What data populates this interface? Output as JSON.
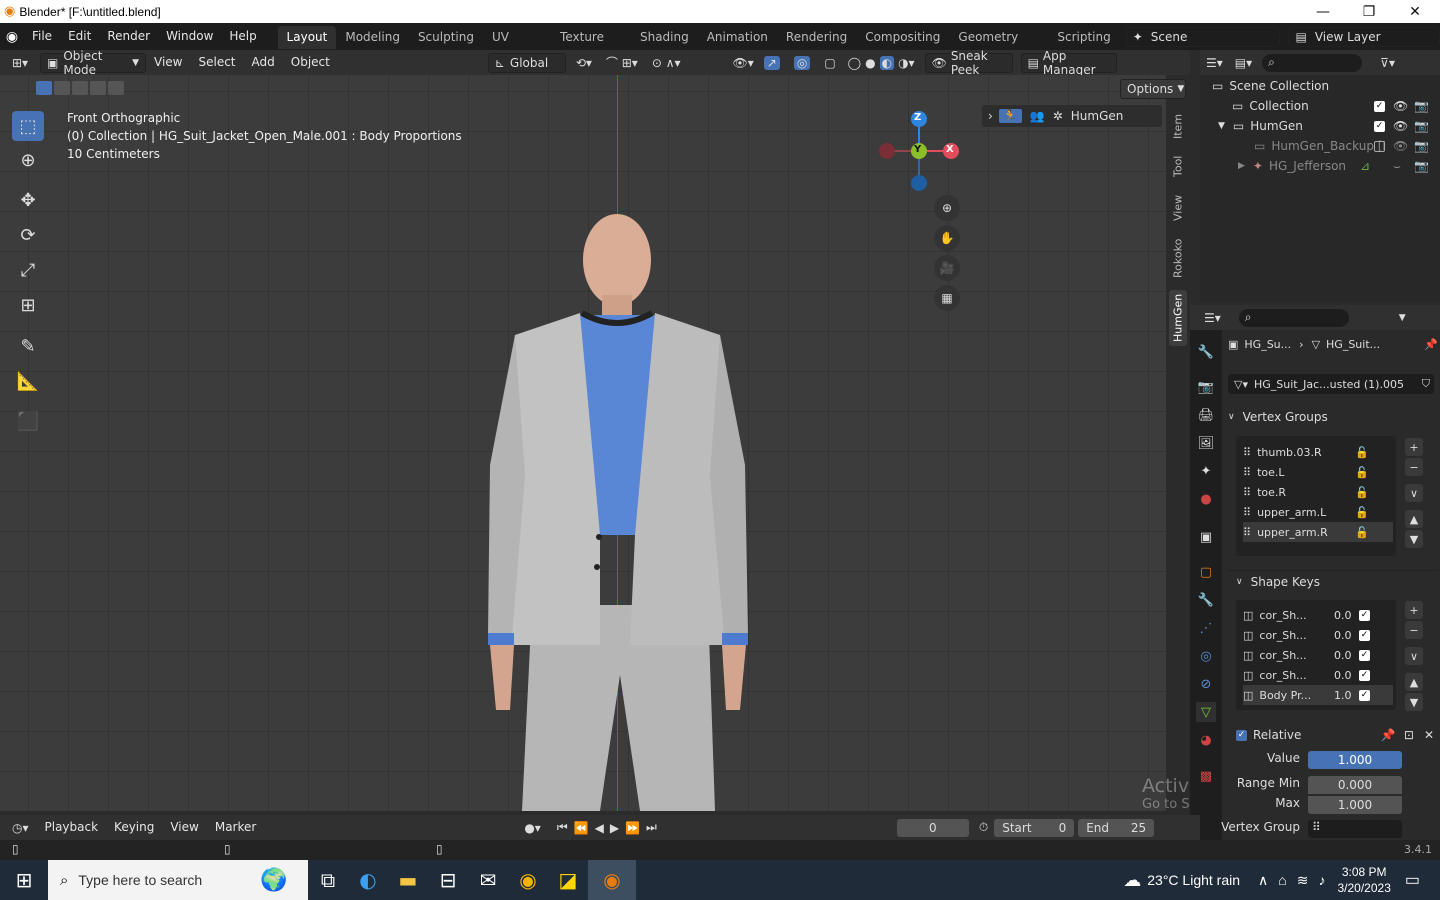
{
  "title_bar": {
    "text": "Blender* [F:\\untitled.blend]",
    "minimize": "—",
    "maximize": "❐",
    "close": "✕"
  },
  "menu": {
    "items": [
      "File",
      "Edit",
      "Render",
      "Window",
      "Help"
    ]
  },
  "workspaces": {
    "tabs": [
      "Layout",
      "Modeling",
      "Sculpting",
      "UV Editing",
      "Texture Paint",
      "Shading",
      "Animation",
      "Rendering",
      "Compositing",
      "Geometry Nodes",
      "Scripting"
    ],
    "active": "Layout"
  },
  "scene": {
    "name": "Scene",
    "view_layer": "View Layer"
  },
  "viewport_header": {
    "mode": "Object Mode",
    "menus": [
      "View",
      "Select",
      "Add",
      "Object"
    ],
    "transform": "Global",
    "sneak_peek": "Sneak Peek",
    "app_manager": "App Manager",
    "options": "Options"
  },
  "viewport": {
    "line1": "Front Orthographic",
    "line2": "(0) Collection | HG_Suit_Jacket_Open_Male.001 : Body Proportions",
    "line3": "10 Centimeters",
    "gizmo_z": "Z",
    "gizmo_y": "Y",
    "gizmo_x": "X",
    "humgen_label": "HumGen"
  },
  "side_tabs": [
    "Item",
    "Tool",
    "View",
    "Rokoko",
    "HumGen"
  ],
  "outliner": {
    "rows": [
      {
        "label": "Scene Collection"
      },
      {
        "label": "Collection"
      },
      {
        "label": "HumGen"
      },
      {
        "label": "HumGen_Backup [I"
      },
      {
        "label": "HG_Jefferson"
      }
    ]
  },
  "properties": {
    "breadcrumb1": "HG_Su...",
    "breadcrumb2": "HG_Suit...",
    "mesh_name": "HG_Suit_Jac...usted (1).005",
    "vertex_groups_title": "Vertex Groups",
    "vertex_groups": [
      "thumb.03.R",
      "toe.L",
      "toe.R",
      "upper_arm.L",
      "upper_arm.R"
    ],
    "shape_keys_title": "Shape Keys",
    "shape_keys": [
      {
        "name": "cor_Sh...",
        "value": "0.0"
      },
      {
        "name": "cor_Sh...",
        "value": "0.0"
      },
      {
        "name": "cor_Sh...",
        "value": "0.0"
      },
      {
        "name": "cor_Sh...",
        "value": "0.0"
      },
      {
        "name": "Body Pr...",
        "value": "1.0"
      }
    ],
    "relative_label": "Relative",
    "value_label": "Value",
    "value": "1.000",
    "range_min_label": "Range Min",
    "range_min": "0.000",
    "max_label": "Max",
    "max": "1.000",
    "vertex_group_label": "Vertex Group"
  },
  "timeline": {
    "menus": [
      "Playback",
      "Keying",
      "View",
      "Marker"
    ],
    "frame": "0",
    "start_label": "Start",
    "start": "0",
    "end_label": "End",
    "end": "25"
  },
  "status": {
    "version": "3.4.1"
  },
  "watermark": {
    "line1": "Activate Windows",
    "line2": "Go to Settings to activate Windows."
  },
  "taskbar": {
    "search_placeholder": "Type here to search",
    "weather": "23°C  Light rain",
    "time": "3:08 PM",
    "date": "3/20/2023"
  },
  "colors": {
    "accent": "#4772b3",
    "blender_orange": "#e87d0d",
    "gizmo_x": "#e34d5b",
    "gizmo_y": "#8bbf2a",
    "gizmo_z": "#2e86de"
  }
}
